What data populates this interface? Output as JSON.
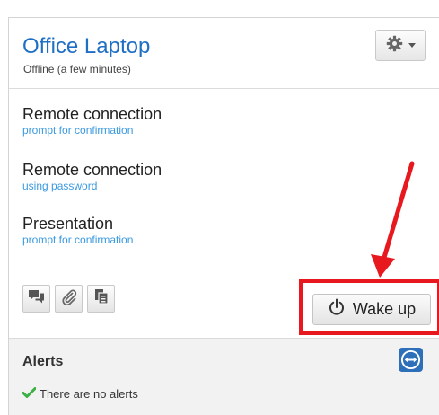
{
  "device": {
    "name": "Office Laptop",
    "status": "Offline (a few minutes)"
  },
  "settings_menu": {
    "icon": "gear-icon",
    "dropdown_icon": "caret-down-icon"
  },
  "actions": [
    {
      "title": "Remote connection",
      "subtitle": "prompt for confirmation"
    },
    {
      "title": "Remote connection",
      "subtitle": "using password"
    },
    {
      "title": "Presentation",
      "subtitle": "prompt for confirmation"
    }
  ],
  "toolbar": {
    "buttons": [
      {
        "icon": "chat-icon"
      },
      {
        "icon": "paperclip-icon"
      },
      {
        "icon": "copy-icon"
      }
    ],
    "wake_button": {
      "icon": "power-icon",
      "label": "Wake up"
    }
  },
  "alerts": {
    "title": "Alerts",
    "message": "There are no alerts",
    "status_icon": "checkmark-icon",
    "logo_icon": "teamviewer-logo-icon"
  },
  "colors": {
    "link": "#1f6fc5",
    "subtitle": "#3a9ae0",
    "highlight": "#e8191e",
    "check": "#3cb043"
  }
}
